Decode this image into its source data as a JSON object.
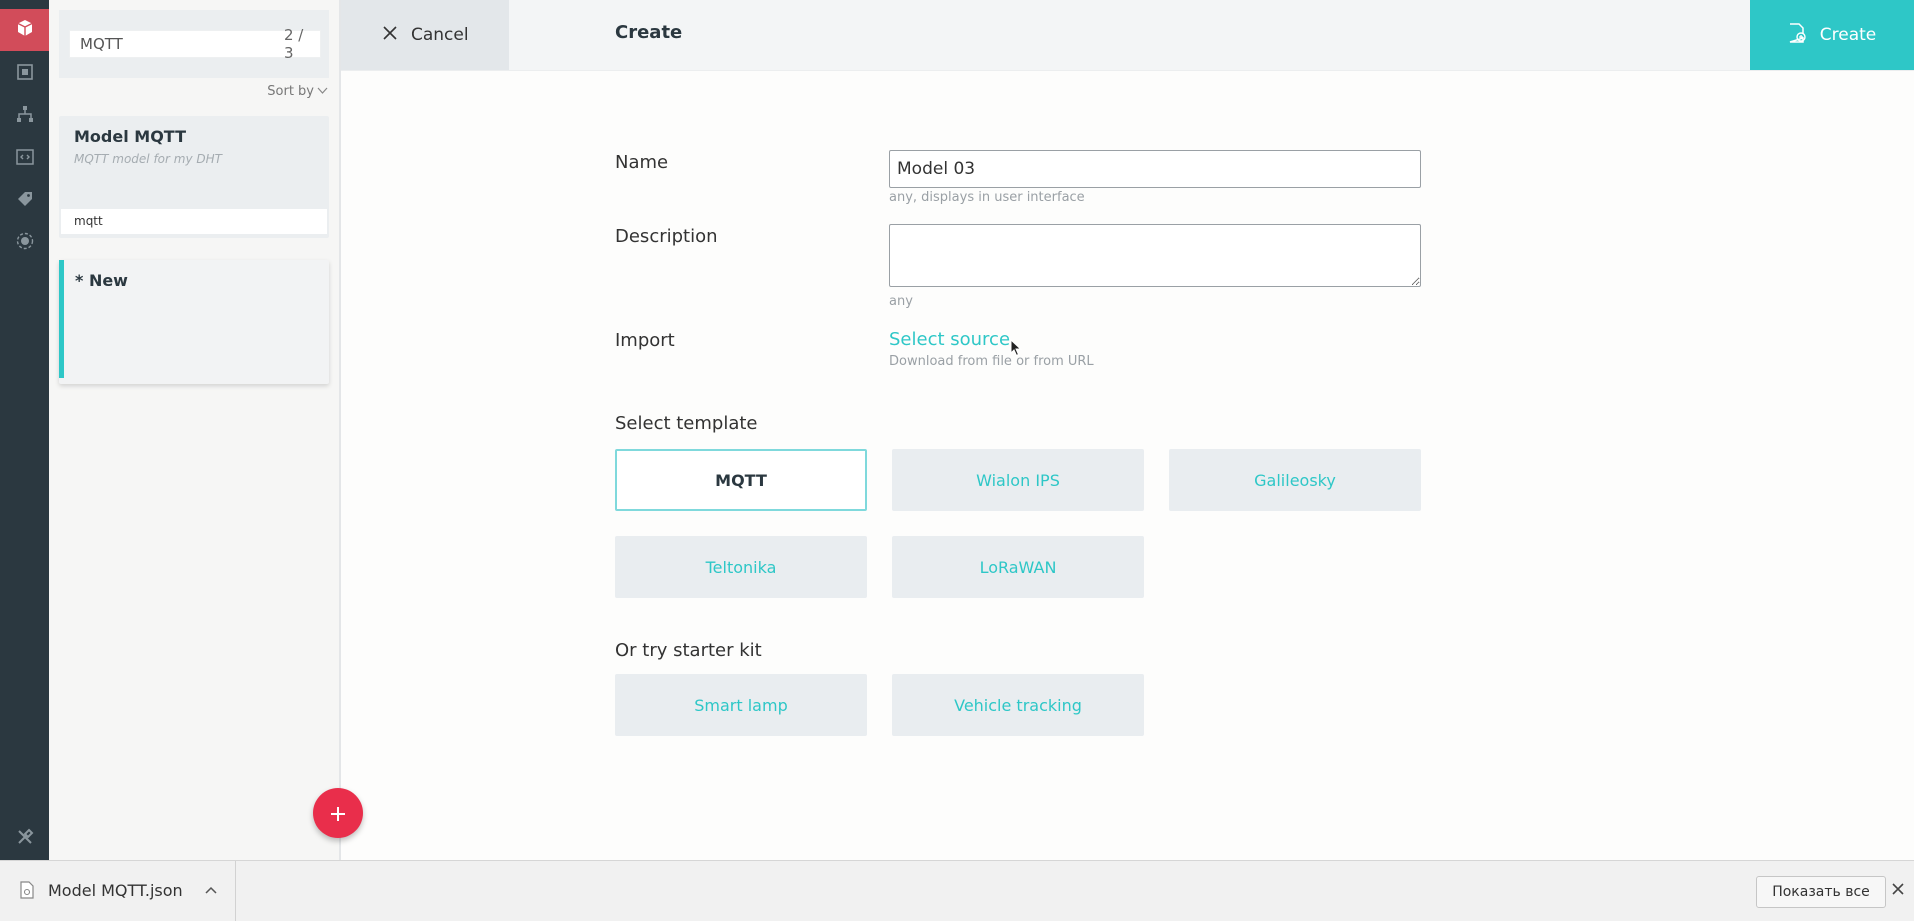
{
  "rail": {
    "items": [
      "box-icon",
      "frame-icon",
      "hierarchy-icon",
      "code-icon",
      "tag-icon",
      "satellite-icon"
    ],
    "footer_icon": "tools-icon",
    "active_color": "#d24c5a"
  },
  "sidebar": {
    "search": {
      "value": "MQTT",
      "count": "2 / 3"
    },
    "sort_label": "Sort by",
    "cards": [
      {
        "title": "Model MQTT",
        "description": "MQTT model for my DHT",
        "tag": "mqtt"
      },
      {
        "title": "* New"
      }
    ]
  },
  "topbar": {
    "cancel_label": "Cancel",
    "title": "Create",
    "create_label": "Create"
  },
  "form": {
    "name_label": "Name",
    "name_value": "Model 03",
    "name_hint": "any, displays in user interface",
    "description_label": "Description",
    "description_value": "",
    "description_hint": "any",
    "import_label": "Import",
    "import_link": "Select source",
    "import_hint": "Download from file or from URL",
    "templates_title": "Select template",
    "templates": [
      "MQTT",
      "Wialon IPS",
      "Galileosky",
      "Teltonika",
      "LoRaWAN"
    ],
    "selected_template": "MQTT",
    "starter_title": "Or try starter kit",
    "starter_kits": [
      "Smart lamp",
      "Vehicle tracking"
    ]
  },
  "downloads": {
    "file_name": "Model MQTT.json",
    "show_all": "Показать все"
  },
  "colors": {
    "accent": "#2ec7c7",
    "fab": "#e92e4b",
    "rail": "#2b3840"
  }
}
